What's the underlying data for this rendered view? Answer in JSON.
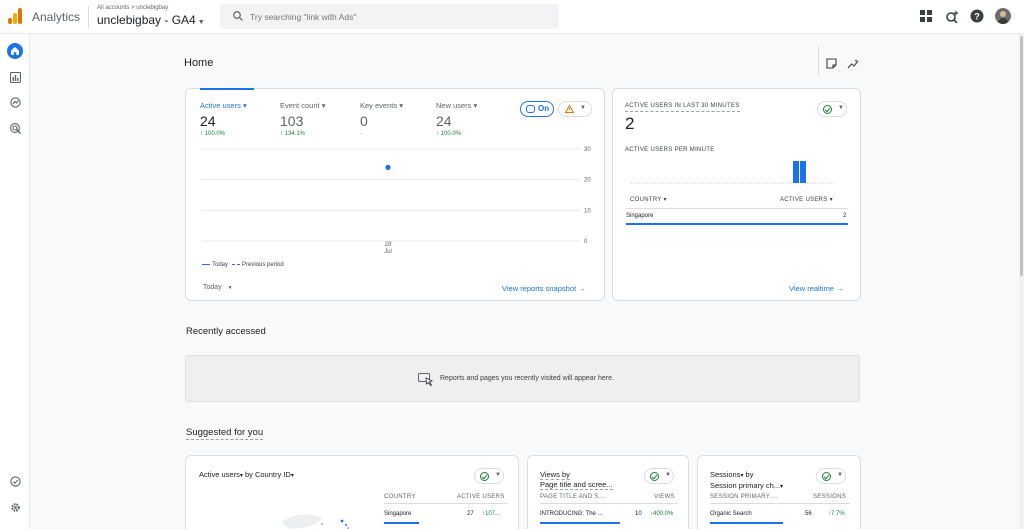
{
  "topbar": {
    "app_name": "Analytics",
    "breadcrumb": "All accounts > unclebigbay",
    "property_name": "unclebigbay - GA4",
    "search_placeholder": "Try searching \"link with Ads\""
  },
  "page": {
    "title": "Home"
  },
  "overview": {
    "metrics": [
      {
        "label": "Active users",
        "value": "24",
        "delta": "100.0%"
      },
      {
        "label": "Event count",
        "value": "103",
        "delta": "134.1%"
      },
      {
        "label": "Key events",
        "value": "0",
        "delta": "-"
      },
      {
        "label": "New users",
        "value": "24",
        "delta": "100.0%"
      }
    ],
    "insights_toggle": "On",
    "date_select": "Today",
    "link": "View reports snapshot",
    "legend": {
      "today": "Today",
      "previous": "Previous period"
    },
    "chart_data": {
      "type": "scatter",
      "x": [
        "28 Jul"
      ],
      "series": [
        {
          "name": "Today",
          "values": [
            24
          ]
        }
      ],
      "xlabel": "",
      "ylabel": "",
      "ylim": [
        0,
        30
      ],
      "yticks": [
        "30",
        "20",
        "10",
        "0"
      ],
      "xtick_day": "28",
      "xtick_month": "Jul",
      "grid": true
    }
  },
  "realtime": {
    "label": "ACTIVE USERS IN LAST 30 MINUTES",
    "value": "2",
    "per_minute_label": "ACTIVE USERS PER MINUTE",
    "col_country": "COUNTRY",
    "col_users": "ACTIVE USERS",
    "rows": [
      {
        "country": "Singapore",
        "users": "2"
      }
    ],
    "link": "View realtime"
  },
  "recent": {
    "title": "Recently accessed",
    "empty_text": "Reports and pages you recently visited will appear here."
  },
  "suggested": {
    "title": "Suggested for you",
    "cards": [
      {
        "title_a": "Active users",
        "title_b": "by Country ID",
        "col1": "COUNTRY",
        "col2": "ACTIVE USERS",
        "row": {
          "name": "Singapore",
          "value": "27",
          "delta": "107..."
        }
      },
      {
        "title_a": "Views by",
        "title_b": "Page title and scree...",
        "col1": "PAGE TITLE AND S...",
        "col2": "VIEWS",
        "row": {
          "name": "INTRODUCING: The ...",
          "value": "10",
          "delta": "400.0%"
        }
      },
      {
        "title_a": "Sessions",
        "title_b": "by",
        "title_c": "Session primary ch...",
        "col1": "SESSION PRIMARY ...",
        "col2": "SESSIONS",
        "row": {
          "name": "Organic Search",
          "value": "56",
          "delta": "7.7%"
        }
      }
    ]
  },
  "colors": {
    "accent": "#1a73e8",
    "positive": "#188038",
    "warning": "#e37400"
  }
}
